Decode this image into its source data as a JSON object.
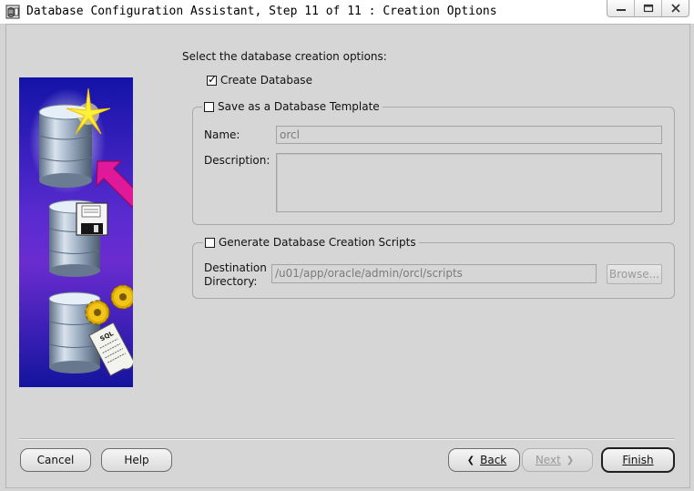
{
  "window": {
    "title": "Database Configuration Assistant, Step 11 of 11 : Creation Options",
    "controls": {
      "minimize": "–",
      "maximize": "□",
      "close": "✕"
    }
  },
  "options": {
    "instruction": "Select the database creation options:",
    "create_database": {
      "label": "Create Database",
      "checked": true
    },
    "template": {
      "label": "Save as a Database Template",
      "checked": false,
      "name_label": "Name:",
      "name_value": "orcl",
      "description_label": "Description:",
      "description_value": ""
    },
    "scripts": {
      "label": "Generate Database Creation Scripts",
      "checked": false,
      "destination_label_line1": "Destination",
      "destination_label_line2": "Directory:",
      "destination_value": "/u01/app/oracle/admin/orcl/scripts",
      "browse_label": "Browse..."
    }
  },
  "buttons": {
    "cancel": "Cancel",
    "help": "Help",
    "back": "Back",
    "next": "Next",
    "finish": "Finish"
  },
  "illustration": {
    "icons": [
      "database-star-icon",
      "pointer-arrow-icon",
      "floppy-disk-icon",
      "gears-icon",
      "sql-script-icon"
    ],
    "script_text": "SQL"
  },
  "colors": {
    "panel_bg": "#d6d6d6",
    "image_gradient_top": "#1818b8",
    "image_gradient_mid": "#7a2bd0",
    "arrow": "#e0189a",
    "star": "#fff23a"
  }
}
